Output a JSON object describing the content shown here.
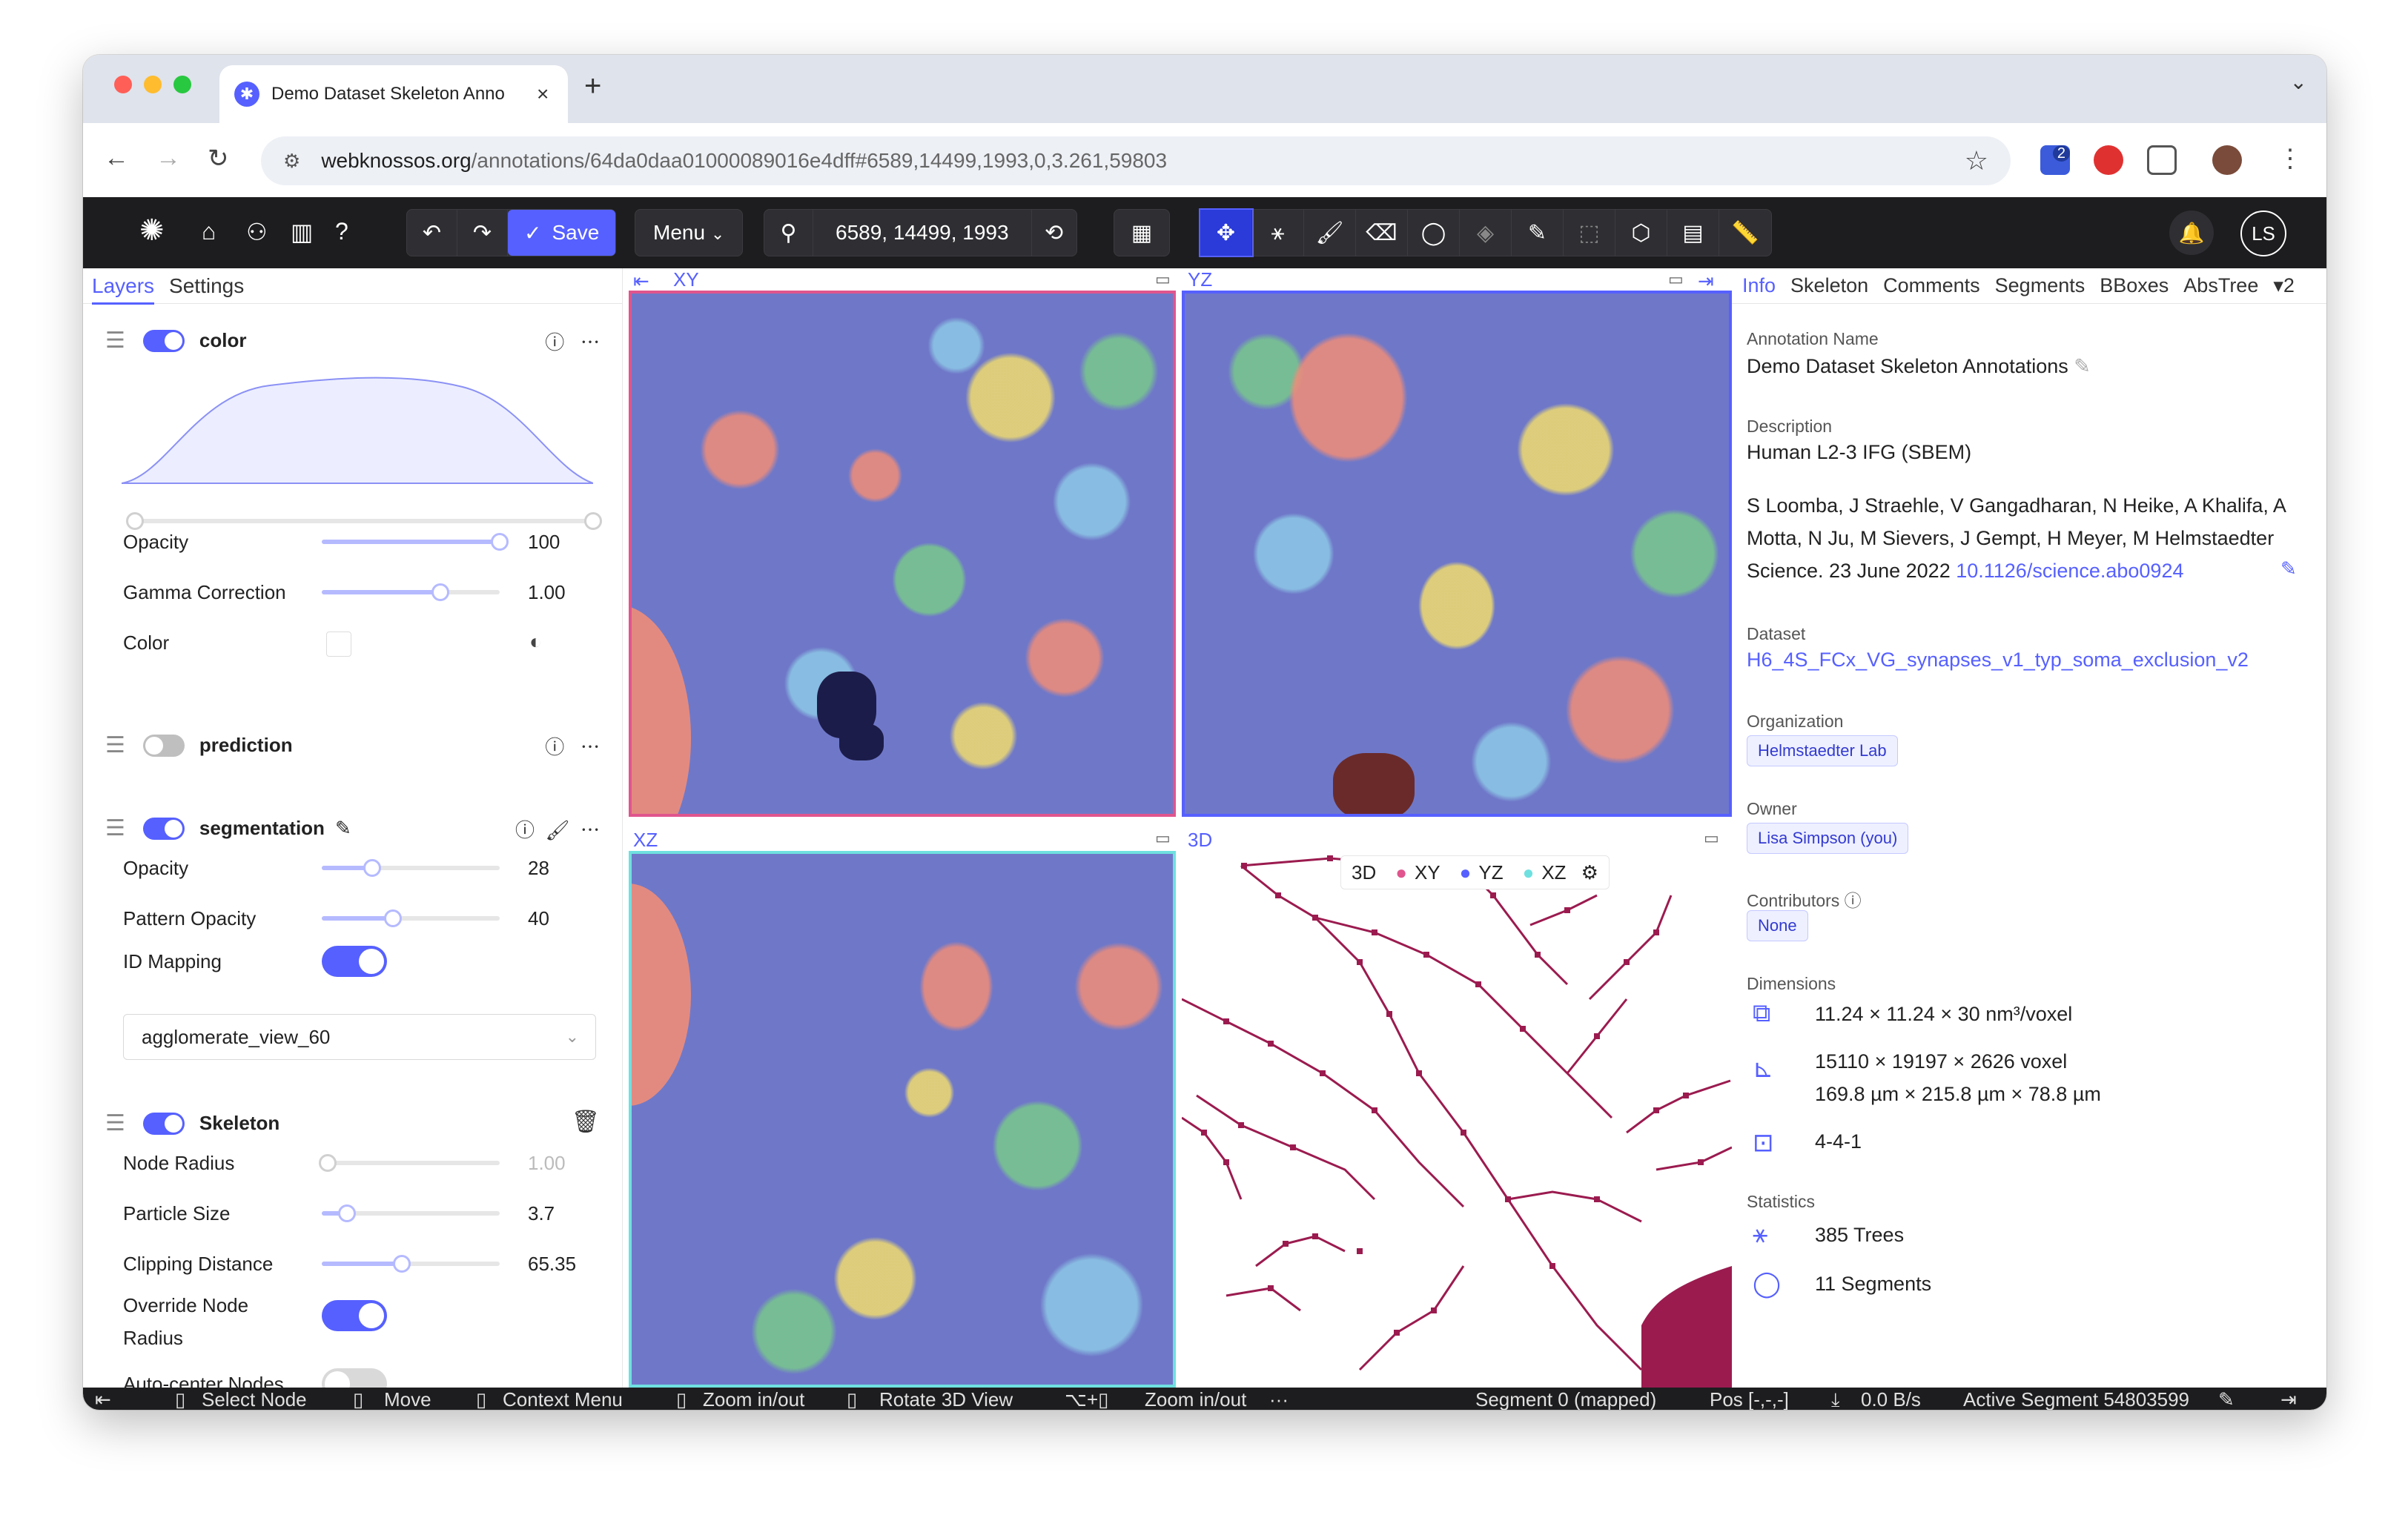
{
  "browser": {
    "tab_title": "Demo Dataset Skeleton Anno",
    "url_host": "webknossos.org",
    "url_path": "/annotations/64da0daa01000089016e4dff#6589,14499,1993,0,3.261,59803",
    "ext_badge": "2"
  },
  "toolbar": {
    "save_label": "Save",
    "menu_label": "Menu",
    "position": "6589, 14499, 1993",
    "avatar_initials": "LS"
  },
  "left_panel": {
    "tabs": [
      "Layers",
      "Settings"
    ],
    "layers": {
      "color": {
        "name": "color",
        "opacity_label": "Opacity",
        "opacity_value": "100",
        "gamma_label": "Gamma Correction",
        "gamma_value": "1.00",
        "color_label": "Color"
      },
      "prediction": {
        "name": "prediction"
      },
      "segmentation": {
        "name": "segmentation",
        "opacity_label": "Opacity",
        "opacity_value": "28",
        "pattern_label": "Pattern Opacity",
        "pattern_value": "40",
        "mapping_label": "ID Mapping",
        "mapping_select": "agglomerate_view_60"
      },
      "skeleton": {
        "name": "Skeleton",
        "node_radius_label": "Node Radius",
        "node_radius_value": "1.00",
        "particle_label": "Particle Size",
        "particle_value": "3.7",
        "clipping_label": "Clipping Distance",
        "clipping_value": "65.35",
        "override_label_1": "Override Node",
        "override_label_2": "Radius",
        "autocenter_label": "Auto-center Nodes"
      }
    }
  },
  "viewports": {
    "xy": "XY",
    "yz": "YZ",
    "xz": "XZ",
    "td": "3D",
    "td_buttons": [
      "3D",
      "XY",
      "YZ",
      "XZ"
    ]
  },
  "right_panel": {
    "tabs": [
      "Info",
      "Skeleton",
      "Comments",
      "Segments",
      "BBoxes",
      "AbsTree"
    ],
    "tabs_more": "2",
    "annotation_name_label": "Annotation Name",
    "annotation_name": "Demo Dataset Skeleton Annotations",
    "description_label": "Description",
    "description_title": "Human L2-3 IFG (SBEM)",
    "description_body_1": "S Loomba, J Straehle, V Gangadharan, N Heike, A Khalifa, A",
    "description_body_2": "Motta, N Ju, M Sievers, J Gempt, H Meyer, M Helmstaedter",
    "description_body_3": "Science. 23 June 2022 ",
    "description_doi": "10.1126/science.abo0924",
    "dataset_label": "Dataset",
    "dataset_name": "H6_4S_FCx_VG_synapses_v1_typ_soma_exclusion_v2",
    "organization_label": "Organization",
    "organization": "Helmstaedter Lab",
    "owner_label": "Owner",
    "owner": "Lisa Simpson (you)",
    "contributors_label": "Contributors",
    "contributors": "None",
    "dimensions_label": "Dimensions",
    "voxel_size": "11.24 × 11.24 × 30 nm³/voxel",
    "extent_voxel": "15110 × 19197 × 2626 voxel",
    "extent_um": "169.8 µm × 215.8 µm × 78.8 µm",
    "mags": "4-4-1",
    "statistics_label": "Statistics",
    "trees": "385 Trees",
    "segments": "11 Segments"
  },
  "statusbar": {
    "select_node": "Select Node",
    "move": "Move",
    "context_menu": "Context Menu",
    "zoom": "Zoom in/out",
    "rotate": "Rotate 3D View",
    "zoom2": "Zoom in/out",
    "more": "···",
    "segment": "Segment 0 (mapped)",
    "pos": "Pos [-,-,-]",
    "speed": "0.0 B/s",
    "active_segment": "Active Segment 54803599"
  },
  "colors": {
    "accent": "#5660ff",
    "toolbar_bg": "#1d1d1f",
    "skeleton": "#9b1b4f",
    "xy_border": "#e0558d",
    "yz_border": "#5660ff",
    "xz_border": "#6fe0e0"
  }
}
